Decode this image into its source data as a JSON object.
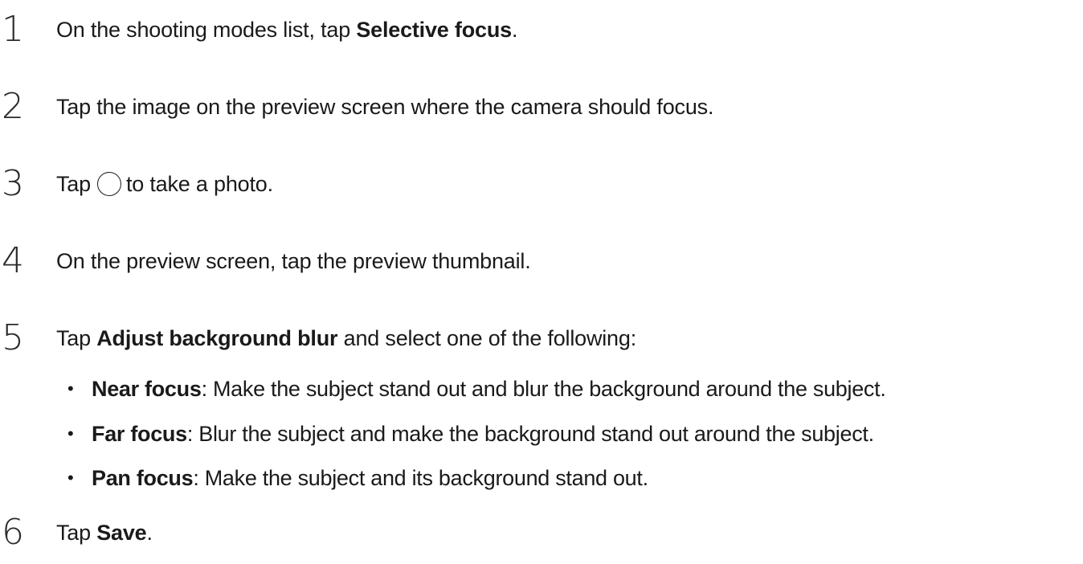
{
  "steps": [
    {
      "number": "1",
      "pre": "On the shooting modes list, tap ",
      "bold": "Selective focus",
      "post": "."
    },
    {
      "number": "2",
      "text": "Tap the image on the preview screen where the camera should focus."
    },
    {
      "number": "3",
      "pre": "Tap",
      "icon": "shutter-circle-icon",
      "post": "to take a photo."
    },
    {
      "number": "4",
      "text": "On the preview screen, tap the preview thumbnail."
    },
    {
      "number": "5",
      "pre": "Tap ",
      "bold": "Adjust background blur",
      "post": " and select one of the following:"
    },
    {
      "number": "6",
      "pre": "Tap ",
      "bold": "Save",
      "post": "."
    }
  ],
  "options": [
    {
      "bullet": "•",
      "term": "Near focus",
      "description": ": Make the subject stand out and blur the background around the subject."
    },
    {
      "bullet": "•",
      "term": "Far focus",
      "description": ": Blur the subject and make the background stand out around the subject."
    },
    {
      "bullet": "•",
      "term": "Pan focus",
      "description": ": Make the subject and its background stand out."
    }
  ]
}
